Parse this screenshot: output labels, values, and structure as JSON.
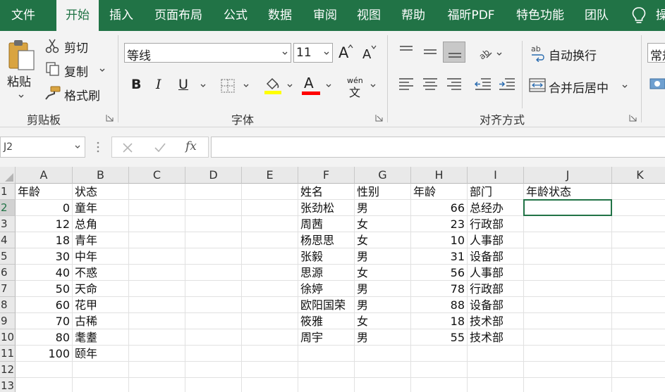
{
  "ribbon_tabs": [
    "文件",
    "开始",
    "插入",
    "页面布局",
    "公式",
    "数据",
    "审阅",
    "视图",
    "帮助",
    "福昕PDF",
    "特色功能",
    "团队"
  ],
  "ribbon_tab_more": "操",
  "clipboard": {
    "paste": "粘贴",
    "cut": "剪切",
    "copy": "复制",
    "format_painter": "格式刷",
    "group_label": "剪贴板"
  },
  "font": {
    "name": "等线",
    "size": "11",
    "bold": "B",
    "italic": "I",
    "underline": "U",
    "grow_glyph": "A",
    "shrink_glyph": "A",
    "font_color_glyph": "A",
    "phonetic_top": "wén",
    "phonetic_bottom": "文",
    "group_label": "字体"
  },
  "alignment": {
    "wrap_text": "自动换行",
    "merge_center": "合并后居中",
    "orientation_glyph": "ab",
    "wrap_icon_text": "ab",
    "group_label": "对齐方式"
  },
  "number": {
    "format": "常规"
  },
  "formula_bar": {
    "name_box": "J2",
    "fx": "fx",
    "formula": ""
  },
  "grid": {
    "columns": [
      "A",
      "B",
      "C",
      "D",
      "E",
      "F",
      "G",
      "H",
      "I",
      "J",
      "K"
    ],
    "rows": [
      "1",
      "2",
      "3",
      "4",
      "5",
      "6",
      "7",
      "8",
      "9",
      "10",
      "11",
      "12",
      "13"
    ],
    "left_table": {
      "headers": [
        "年龄",
        "状态"
      ],
      "rows": [
        [
          "0",
          "童年"
        ],
        [
          "12",
          "总角"
        ],
        [
          "18",
          "青年"
        ],
        [
          "30",
          "中年"
        ],
        [
          "40",
          "不惑"
        ],
        [
          "50",
          "天命"
        ],
        [
          "60",
          "花甲"
        ],
        [
          "70",
          "古稀"
        ],
        [
          "80",
          "耄耋"
        ],
        [
          "100",
          "颐年"
        ]
      ]
    },
    "right_table": {
      "headers": [
        "姓名",
        "性别",
        "年龄",
        "部门",
        "年龄状态"
      ],
      "rows": [
        [
          "张劲松",
          "男",
          "66",
          "总经办"
        ],
        [
          "周茜",
          "女",
          "23",
          "行政部"
        ],
        [
          "杨思思",
          "女",
          "10",
          "人事部"
        ],
        [
          "张毅",
          "男",
          "31",
          "设备部"
        ],
        [
          "思源",
          "女",
          "56",
          "人事部"
        ],
        [
          "徐婷",
          "男",
          "78",
          "行政部"
        ],
        [
          "欧阳国荣",
          "男",
          "88",
          "设备部"
        ],
        [
          "筱雅",
          "女",
          "18",
          "技术部"
        ],
        [
          "周宇",
          "男",
          "55",
          "技术部"
        ]
      ]
    }
  },
  "colors": {
    "accent": "#217346",
    "highlight": "#ffff00",
    "font_color": "#ff0000"
  }
}
